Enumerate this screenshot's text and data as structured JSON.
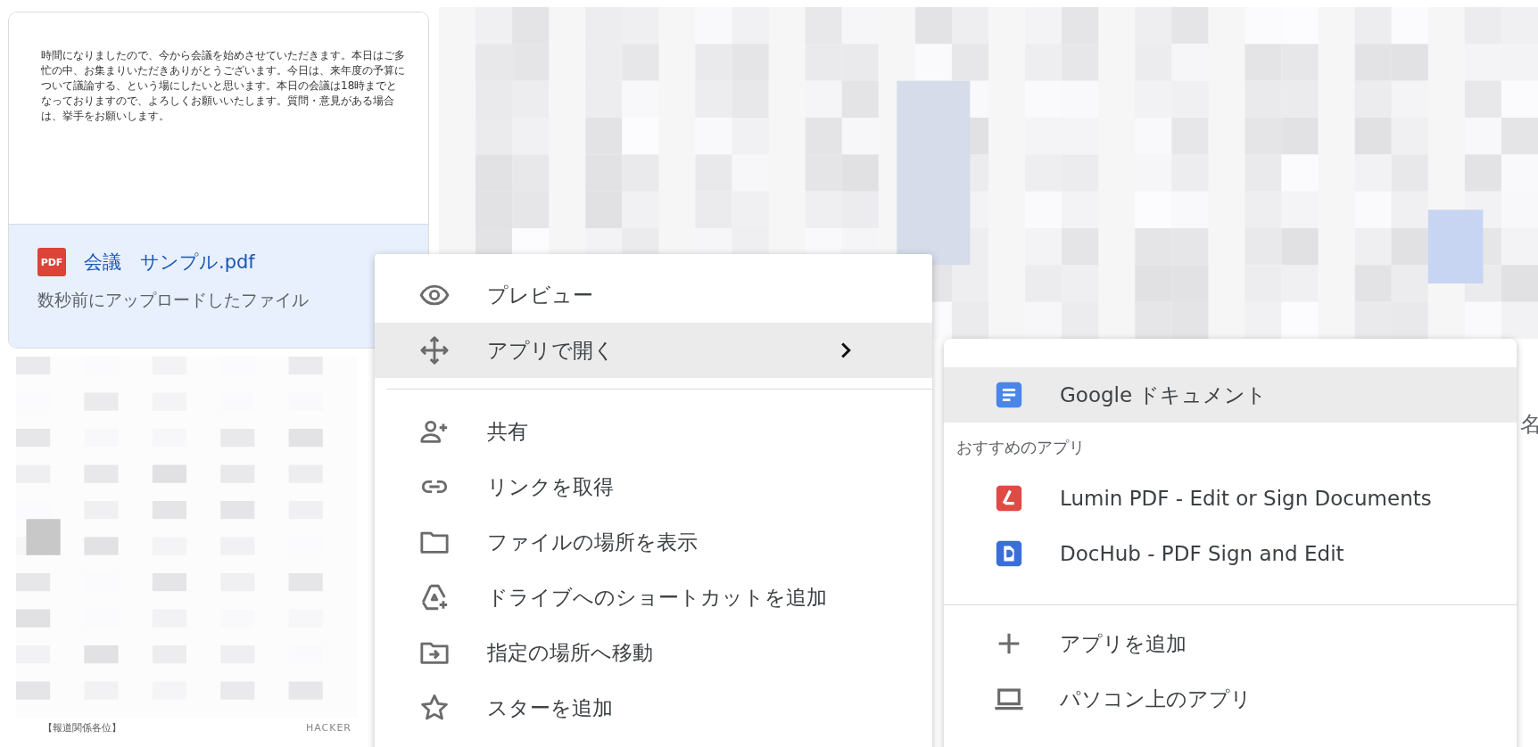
{
  "file_card": {
    "selected": true,
    "preview_text": "時間になりましたので、今から会議を始めさせていただきます。本日はご多忙の中、お集まりいただきありがとうございます。今日は、来年度の予算について議論する、という場にしたいと思います。本日の会議は18時までとなっておりますので、よろしくお願いいたします。質問・意見がある場合は、挙手をお願いします。",
    "file_type": "PDF",
    "file_name": "会議　サンプル.pdf",
    "subtitle": "数秒前にアップロードしたファイル"
  },
  "second_card": {
    "footer_left": "【報道関係各位】",
    "footer_right": "HACKER"
  },
  "right_edge_text": "名",
  "context_menu": {
    "items": [
      {
        "kind": "item",
        "label": "プレビュー",
        "highlighted": false,
        "submenu": false
      },
      {
        "kind": "item",
        "label": "アプリで開く",
        "highlighted": true,
        "submenu": true
      },
      {
        "kind": "divider"
      },
      {
        "kind": "item",
        "label": "共有",
        "highlighted": false,
        "submenu": false
      },
      {
        "kind": "item",
        "label": "リンクを取得",
        "highlighted": false,
        "submenu": false
      },
      {
        "kind": "item",
        "label": "ファイルの場所を表示",
        "highlighted": false,
        "submenu": false
      },
      {
        "kind": "item",
        "label": "ドライブへのショートカットを追加",
        "highlighted": false,
        "submenu": false
      },
      {
        "kind": "item",
        "label": "指定の場所へ移動",
        "highlighted": false,
        "submenu": false
      },
      {
        "kind": "item",
        "label": "スターを追加",
        "highlighted": false,
        "submenu": false
      }
    ]
  },
  "submenu": {
    "items": [
      {
        "kind": "app",
        "label": "Google ドキュメント",
        "highlighted": true,
        "color": "#4a86e8"
      },
      {
        "kind": "heading",
        "label": "おすすめのアプリ"
      },
      {
        "kind": "app",
        "label": "Lumin PDF - Edit or Sign Documents",
        "highlighted": false,
        "color": "#e04a45"
      },
      {
        "kind": "app",
        "label": "DocHub - PDF Sign and Edit",
        "highlighted": false,
        "color": "#3a6fd8"
      },
      {
        "kind": "divider"
      },
      {
        "kind": "action",
        "label": "アプリを追加",
        "highlighted": false
      },
      {
        "kind": "action",
        "label": "パソコン上のアプリ",
        "highlighted": false
      }
    ]
  }
}
